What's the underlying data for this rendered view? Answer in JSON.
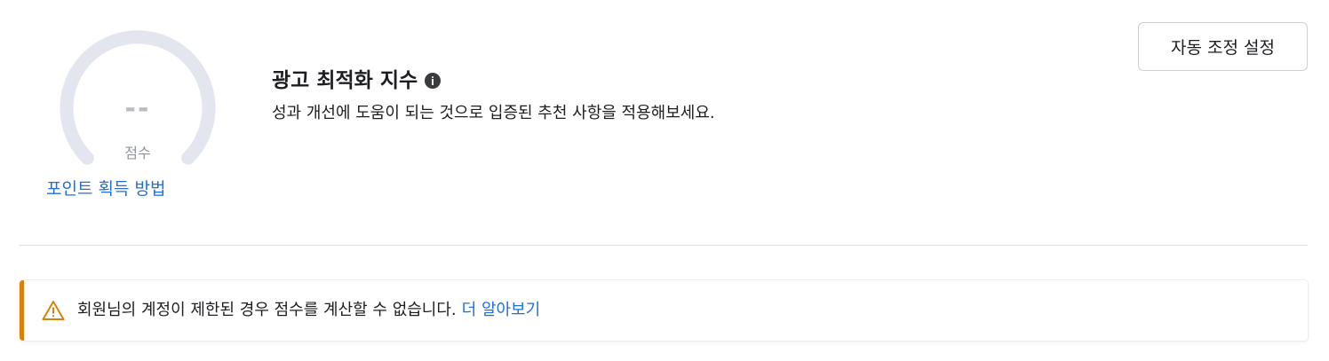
{
  "gauge": {
    "value": "--",
    "label": "점수",
    "points_link": "포인트 획득 방법"
  },
  "header": {
    "title": "광고 최적화 지수",
    "subtitle": "성과 개선에 도움이 되는 것으로 입증된 추천 사항을 적용해보세요.",
    "auto_adjust_button": "자동 조정 설정"
  },
  "banner": {
    "message": "회원님의 계정이 제한된 경우 점수를 계산할 수 없습니다.",
    "link": "더 알아보기"
  },
  "colors": {
    "link": "#216fdb",
    "warning": "#d9820b",
    "gauge_track": "#e4e6ef"
  },
  "icons": {
    "info": "info-icon",
    "warning": "warning-triangle-icon"
  }
}
